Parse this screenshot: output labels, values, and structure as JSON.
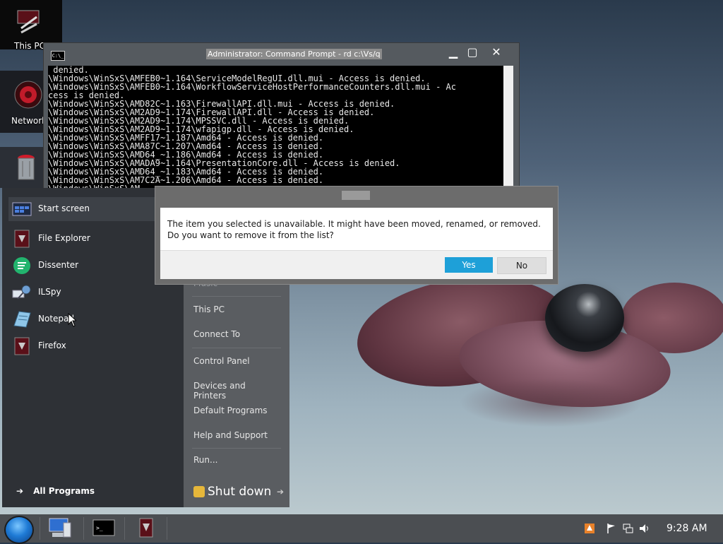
{
  "desktop": {
    "icons": [
      {
        "label": "This PC"
      },
      {
        "label": "Network"
      },
      {
        "label": ""
      }
    ]
  },
  "cmd": {
    "icon_text": "C:\\_",
    "title": "Administrator: Command Prompt - rd  c:\\Vs/q",
    "lines": [
      " denied.",
      "\\Windows\\WinSxS\\AMFEB0~1.164\\ServiceModelRegUI.dll.mui - Access is denied.",
      "\\Windows\\WinSxS\\AMFEB0~1.164\\WorkflowServiceHostPerformanceCounters.dll.mui - Ac",
      "cess is denied.",
      "\\Windows\\WinSxS\\AMD82C~1.163\\FirewallAPI.dll.mui - Access is denied.",
      "\\Windows\\WinSxS\\AM2AD9~1.174\\FirewallAPI.dll - Access is denied.",
      "\\Windows\\WinSxS\\AM2AD9~1.174\\MPSSVC.dll - Access is denied.",
      "\\Windows\\WinSxS\\AM2AD9~1.174\\wfapigp.dll - Access is denied.",
      "\\Windows\\WinSxS\\AMFF17~1.187\\Amd64 - Access is denied.",
      "\\Windows\\WinSxS\\AMA87C~1.207\\Amd64 - Access is denied.",
      "\\Windows\\WinSxS\\AMD64_~1.186\\Amd64 - Access is denied.",
      "\\Windows\\WinSxS\\AMADA9~1.164\\PresentationCore.dll - Access is denied.",
      "\\Windows\\WinSxS\\AMD64_~1.183\\Amd64 - Access is denied.",
      "\\Windows\\WinSxS\\AM7C2A~1.206\\Amd64 - Access is denied.",
      "\\Windows\\WinSxS\\AM"
    ]
  },
  "start_menu": {
    "left_items": [
      {
        "label": "Start screen",
        "icon": "start-screen-icon",
        "color": "#3b6fc9"
      },
      {
        "label": "File Explorer",
        "icon": "file-explorer-icon",
        "color": "#7a1a22"
      },
      {
        "label": "Dissenter",
        "icon": "dissenter-icon",
        "color": "#22b46e"
      },
      {
        "label": "ILSpy",
        "icon": "ilspy-icon",
        "color": "#6e9fd4"
      },
      {
        "label": "Notepad",
        "icon": "notepad-icon",
        "color": "#7ab8e0"
      },
      {
        "label": "Firefox",
        "icon": "firefox-icon",
        "color": "#7a1a22"
      }
    ],
    "all_programs": "All Programs",
    "right_items": [
      {
        "label": "Music"
      },
      {
        "label": "This PC"
      },
      {
        "label": "Connect To"
      },
      {
        "label": "Control Panel"
      },
      {
        "label": "Devices and Printers"
      },
      {
        "label": "Default Programs"
      },
      {
        "label": "Help and Support"
      },
      {
        "label": "Run..."
      }
    ],
    "shutdown": "Shut down"
  },
  "dialog": {
    "message": "The item you selected is unavailable.  It might have been moved, renamed, or removed.  Do you want to remove it from the list?",
    "yes": "Yes",
    "no": "No",
    "accent": "#1ea0d8"
  },
  "taskbar": {
    "clock": "9:28 AM"
  }
}
